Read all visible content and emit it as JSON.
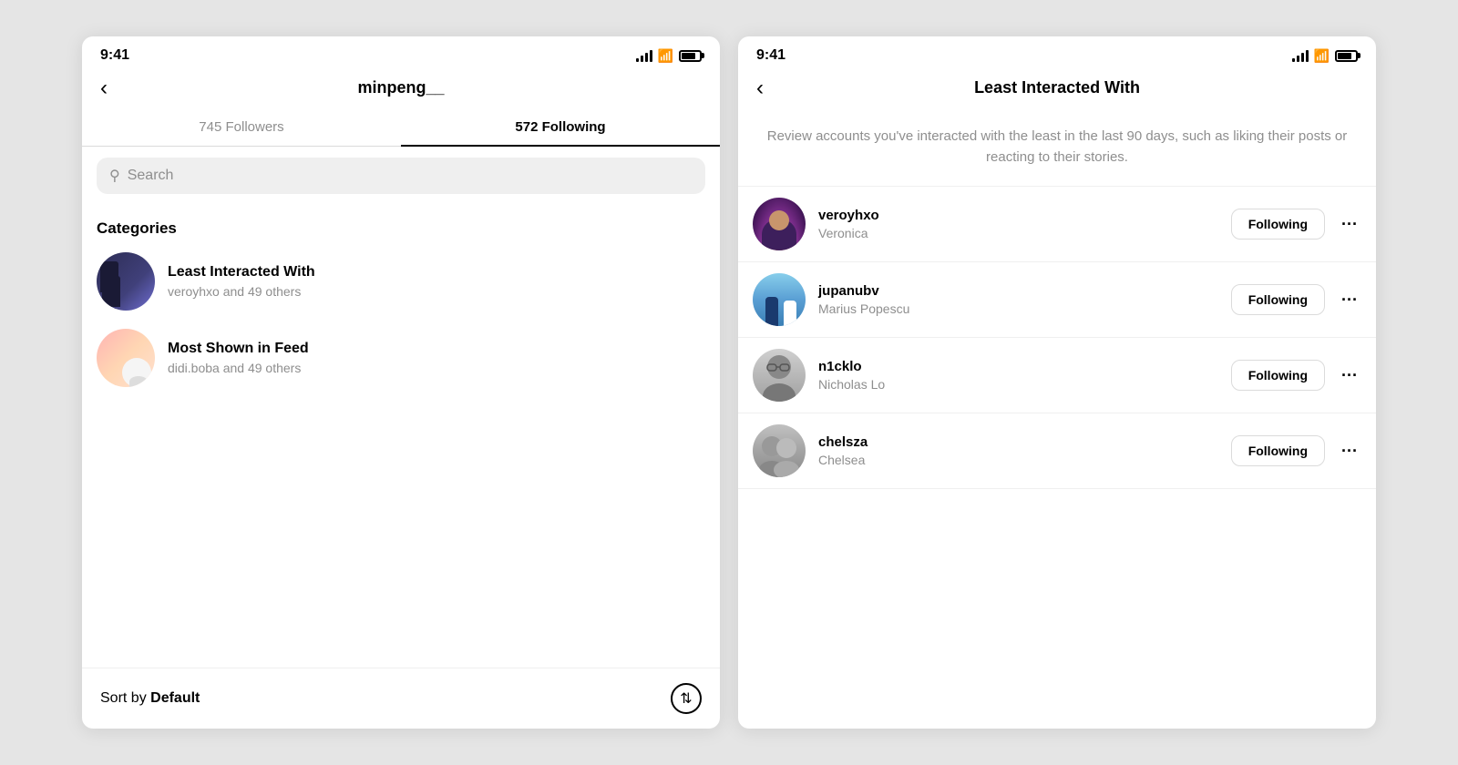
{
  "screen1": {
    "status_time": "9:41",
    "nav_title": "minpeng__",
    "back_label": "‹",
    "tabs": [
      {
        "label": "745 Followers",
        "active": false
      },
      {
        "label": "572 Following",
        "active": true
      }
    ],
    "search_placeholder": "Search",
    "categories_title": "Categories",
    "categories": [
      {
        "name": "Least Interacted With",
        "subtitle": "veroyhxo and 49 others"
      },
      {
        "name": "Most Shown in Feed",
        "subtitle": "didi.boba and 49 others"
      }
    ],
    "sort_label": "Sort by",
    "sort_value": "Default"
  },
  "screen2": {
    "status_time": "9:41",
    "nav_title": "Least Interacted With",
    "back_label": "‹",
    "description": "Review accounts you've interacted with the least in the last 90 days, such as liking their posts or reacting to their stories.",
    "users": [
      {
        "handle": "veroyhxo",
        "name": "Veronica",
        "following_label": "Following"
      },
      {
        "handle": "jupanubv",
        "name": "Marius Popescu",
        "following_label": "Following"
      },
      {
        "handle": "n1cklo",
        "name": "Nicholas Lo",
        "following_label": "Following"
      },
      {
        "handle": "chelsza",
        "name": "Chelsea",
        "following_label": "Following"
      }
    ],
    "more_icon": "···"
  }
}
